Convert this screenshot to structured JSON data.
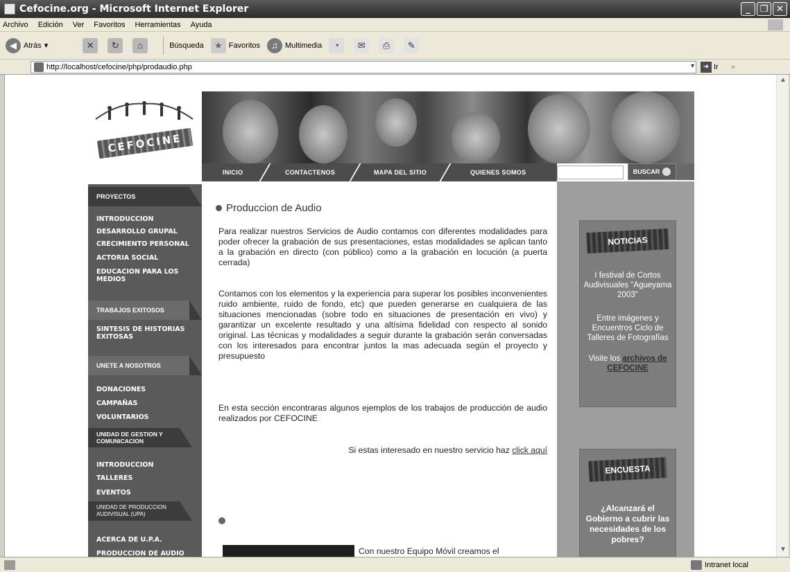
{
  "window": {
    "title": "Cefocine.org - Microsoft Internet Explorer"
  },
  "menu": [
    "Archivo",
    "Edición",
    "Ver",
    "Favoritos",
    "Herramientas",
    "Ayuda"
  ],
  "toolbar": {
    "back": "Atrás",
    "search": "Búsqueda",
    "favorites": "Favoritos",
    "media": "Multimedia"
  },
  "address": {
    "url": "http://localhost/cefocine/php/prodaudio.php",
    "go": "Ir"
  },
  "logo": {
    "text": "CEFOCINE"
  },
  "nav": [
    "INICIO",
    "CONTACTENOS",
    "MAPA DEL SITIO",
    "QUIENES SOMOS"
  ],
  "search": {
    "button": "BUSCAR"
  },
  "sidebar": {
    "proyectos": "PROYECTOS",
    "proyectos_items": [
      "INTRODUCCION",
      "DESARROLLO GRUPAL",
      "CRECIMIENTO PERSONAL",
      "ACTORIA SOCIAL",
      "EDUCACION PARA LOS MEDIOS"
    ],
    "trabajos": "TRABAJOS EXITOSOS",
    "trabajos_items": [
      "SINTESIS DE HISTORIAS EXITOSAS"
    ],
    "unete": "UNETE A NOSOTROS",
    "unete_items": [
      "DONACIONES",
      "CAMPAÑAS",
      "VOLUNTARIOS"
    ],
    "unidad_gestion": "UNIDAD DE GESTION Y COMUNICACION",
    "unidad_gestion_items": [
      "INTRODUCCION",
      "TALLERES",
      "EVENTOS"
    ],
    "upa": "UNIDAD DE PRODUCCION AUDIVISUAL (UPA)",
    "upa_items": [
      "ACERCA DE U.P.A.",
      "PRODUCCION DE AUDIO"
    ]
  },
  "main": {
    "title": "Produccion de Audio",
    "p1": "Para realizar nuestros Servicios de Audio contamos con diferentes modalidades para poder ofrecer la grabación de sus presentaciones, estas modalidades se aplican tanto a la grabación en directo (con público) como a la grabación en locución (a puerta cerrada)",
    "p2": "Contamos con los elementos y la experiencia para superar los posibles inconvenientes ruido ambiente, ruido de fondo, etc) que pueden generarse en cualquiera de las situaciones mencionadas (sobre todo en situaciones de presentación en vivo) y garantizar un excelente resultado y una altísima fidelidad con respecto al sonido original. Las técnicas y modalidades a seguir durante la grabación serán conversadas con los interesados para encontrar juntos la mas adecuada según el proyecto y presupuesto",
    "p3": "En esta sección encontraras algunos ejemplos de los trabajos de producción de audio realizados por CEFOCINE",
    "contact_text": "Si estas interesado en nuestro servicio haz",
    "contact_link": "click aquí",
    "movil": "Con nuestro Equipo Móvil creamos el"
  },
  "noticias": {
    "head": "NOTICIAS",
    "item1": "I festival de Cortos Audivisuales \"Agueyama 2003\"",
    "item2": "Entre imágenes y Encuentros Ciclo de Talleres de Fotografías",
    "visit": "Visite los",
    "link": "archivos de CEFOCINE"
  },
  "encuesta": {
    "head": "ENCUESTA",
    "question": "¿Alcanzará el Gobierno a cubrir las necesidades de los pobres?"
  },
  "status": {
    "zone": "Intranet local"
  }
}
